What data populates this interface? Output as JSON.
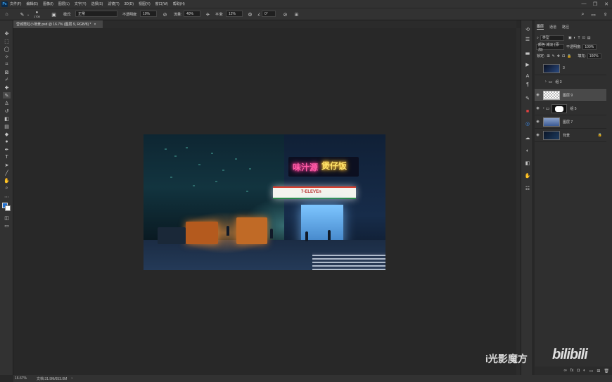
{
  "menubar": {
    "logo": "Ps",
    "items": [
      "文件(F)",
      "编辑(E)",
      "图像(I)",
      "图层(L)",
      "文字(Y)",
      "选择(S)",
      "滤镜(T)",
      "3D(D)",
      "视图(V)",
      "窗口(W)",
      "帮助(H)"
    ],
    "minimize": "—",
    "restore": "❐",
    "close": "✕"
  },
  "options": {
    "brush_size": "1700",
    "mode_label": "模式:",
    "mode_value": "正常",
    "opacity_label": "不透明度:",
    "opacity_value": "10%",
    "flow_label": "流量:",
    "flow_value": "40%",
    "smooth_label": "平滑:",
    "smooth_value": "12%",
    "angle_value": "0°"
  },
  "document": {
    "tab_title": "营城霓虹小场景.psd @ 16.7% (图层 9, RGB/8) *",
    "tab_close": "×"
  },
  "scene": {
    "neon_left": "味汁源",
    "neon_right": "煲仔饭",
    "store_sign": "7-ELEVEn"
  },
  "panel": {
    "tabs": [
      "图层",
      "通道",
      "路径"
    ],
    "filter_value": "类型",
    "blend_value": "颜色 减淡 (添加)",
    "opacity_label": "不透明度:",
    "opacity_value": "100%",
    "lock_label": "锁定:",
    "fill_label": "填充:",
    "fill_value": "100%",
    "layers": [
      {
        "name": "3",
        "visible": false,
        "selected": false
      },
      {
        "name": "组 3",
        "visible": false,
        "selected": false
      },
      {
        "name": "图层 9",
        "visible": true,
        "selected": true
      },
      {
        "name": "组 5",
        "visible": true,
        "selected": false
      },
      {
        "name": "图层 7",
        "visible": true,
        "selected": false
      },
      {
        "name": "背景",
        "visible": true,
        "selected": false
      }
    ]
  },
  "status": {
    "zoom": "16.67%",
    "doc_info": "文档:31.9M/653.0M"
  },
  "watermark": {
    "text": "i光影魔方",
    "brand": "bilibili"
  }
}
